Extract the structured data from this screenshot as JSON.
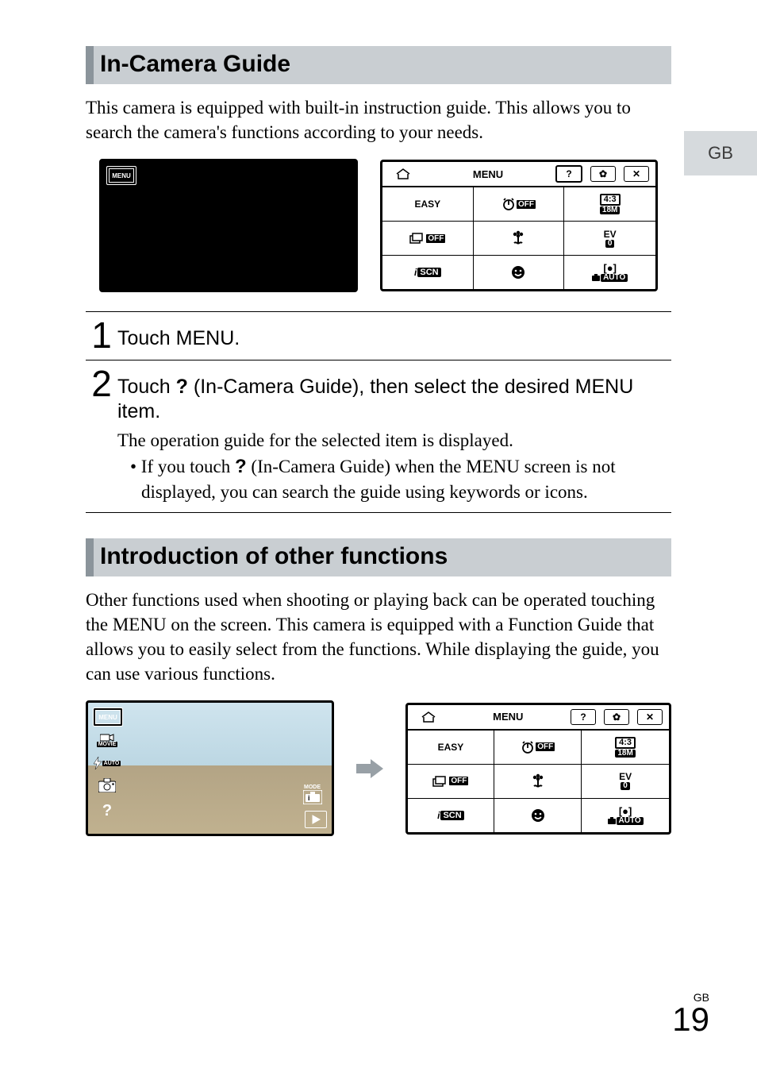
{
  "sideTab": "GB",
  "section1": {
    "heading": "In-Camera Guide",
    "intro": "This camera is equipped with built-in instruction guide. This allows you to search the camera's functions according to your needs."
  },
  "menuPanel": {
    "title": "MENU",
    "topIcons": {
      "home": "home-icon",
      "help": "?",
      "gear": "✿",
      "close": "✕"
    },
    "cells": {
      "easy": "EASY",
      "timerOff": "OFF",
      "ratio": "4:3",
      "ratioSize": "18M",
      "burstOff": "OFF",
      "ev": "EV",
      "evVal": "0",
      "iscn": "SCN",
      "auto": "AUTO"
    }
  },
  "steps": {
    "s1": {
      "num": "1",
      "text": "Touch MENU."
    },
    "s2": {
      "num": "2",
      "prefix": "Touch ",
      "qmark": "?",
      "mid": " (In-Camera Guide), then select the desired MENU item.",
      "note": "The operation guide for the selected item is displayed.",
      "bulletPrefix": "• If you touch ",
      "bulletQ": "?",
      "bulletRest": " (In-Camera Guide) when the MENU screen is not displayed, you can search the guide using keywords or icons."
    }
  },
  "section2": {
    "heading": "Introduction of other functions",
    "intro": "Other functions used when shooting or playing back can be operated touching the MENU on the screen. This camera is equipped with a Function Guide that allows you to easily select from the functions. While displaying the guide, you can use various functions."
  },
  "sideIcons": {
    "menu": "MENU",
    "movie": "MOVIE",
    "flash": "AUTO",
    "mode": "MODE"
  },
  "pageNumber": {
    "lang": "GB",
    "num": "19"
  }
}
